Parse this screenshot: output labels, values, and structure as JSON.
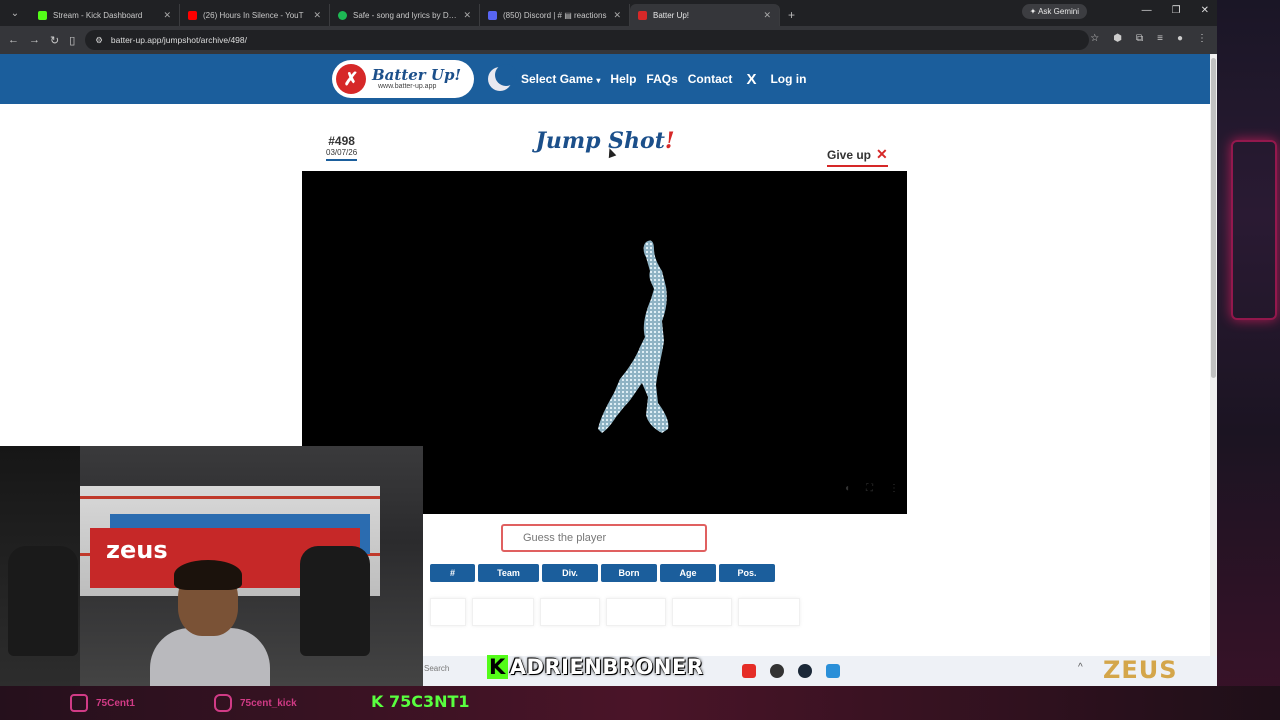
{
  "browser": {
    "tabs": [
      {
        "label": "Stream - Kick Dashboard",
        "color": "#53fc18"
      },
      {
        "label": "(26) Hours In Silence - YouT",
        "color": "#ff0000"
      },
      {
        "label": "Safe - song and lyrics by Drū C",
        "color": "#1db954"
      },
      {
        "label": "(850) Discord | # ▤ reactions",
        "color": "#5865f2"
      },
      {
        "label": "Batter Up!",
        "color": "#d62828"
      }
    ],
    "new_tab": "+",
    "ask_gemini": "Ask Gemini",
    "url": "batter-up.app/jumpshot/archive/498/"
  },
  "site": {
    "logo_title": "Batter Up!",
    "logo_sub": "www.batter-up.app",
    "nav": {
      "select_game": "Select Game",
      "help": "Help",
      "faqs": "FAQs",
      "contact": "Contact",
      "x_logo": "X",
      "login": "Log in"
    },
    "puzzle_number": "#498",
    "puzzle_date": "03/07/26",
    "title": "Jump Shot",
    "title_bang": "!",
    "give_up": "Give up",
    "guess_placeholder": "Guess the player",
    "columns": [
      "#",
      "Team",
      "Div.",
      "Born",
      "Age",
      "Pos."
    ]
  },
  "taskbar": {
    "search": "Search",
    "sponsor": "ZEUS"
  },
  "overlay": {
    "kick_handle": "ADRIENBRONER",
    "kick_letter": "K",
    "twitch_handle": "75Cent1",
    "instagram_handle": "75cent_kick",
    "code": "K 75C3NT1",
    "webcam_brand": "zeus"
  },
  "colors": {
    "site_blue": "#1b5e9c",
    "accent_red": "#d62828",
    "kick_green": "#53fc18"
  }
}
